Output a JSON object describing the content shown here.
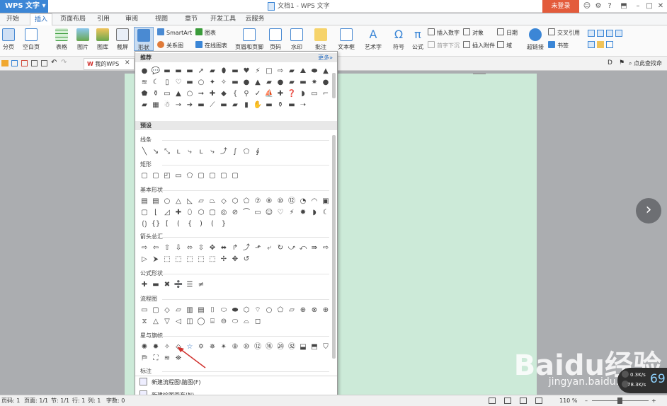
{
  "window": {
    "app_button": "WPS 文字",
    "title": "文档1 - WPS 文字",
    "login": "未登录"
  },
  "tabs": [
    "开始",
    "插入",
    "页面布局",
    "引用",
    "审阅",
    "视图",
    "章节",
    "开发工具",
    "云服务"
  ],
  "active_tab": "插入",
  "ribbon": {
    "large": [
      "分页",
      "空白页",
      "表格",
      "图片",
      "图库",
      "截屏",
      "形状",
      "页眉和页脚",
      "页码",
      "水印",
      "批注",
      "文本框",
      "艺术字",
      "符号",
      "公式",
      "超链接"
    ],
    "small": [
      "SmartArt",
      "图表",
      "关系图",
      "在线图表",
      "插入数字",
      "对象",
      "日期",
      "首字下沉",
      "插入附件",
      "域",
      "交叉引用",
      "书签"
    ]
  },
  "doc_tab": "我的WPS",
  "search": "点此查找命",
  "panel": {
    "recommend": "推荐",
    "more": "更多»",
    "preset": "预设",
    "sections": [
      "线条",
      "矩形",
      "基本形状",
      "箭头总汇",
      "公式形状",
      "流程图",
      "星与旗帜",
      "标注"
    ],
    "bottom_items": [
      "新建流程图\\脑图(F)",
      "新建绘图画布(N)"
    ]
  },
  "status": {
    "page": "页码: 1",
    "pages": "页面: 1/1",
    "section": "节: 1/1",
    "line": "行: 1",
    "col": "列: 1",
    "words": "字数: 0",
    "zoom": "110 %"
  },
  "watermark": {
    "brand": "Baidu经验",
    "url": "jingyan.baidu.com"
  },
  "net": {
    "up": "0.3K/s",
    "down": "78.3K/s",
    "value": "69"
  },
  "colors": {
    "accent": "#3b86d6",
    "login": "#e35b3b",
    "page_bg": "#ccead8"
  }
}
